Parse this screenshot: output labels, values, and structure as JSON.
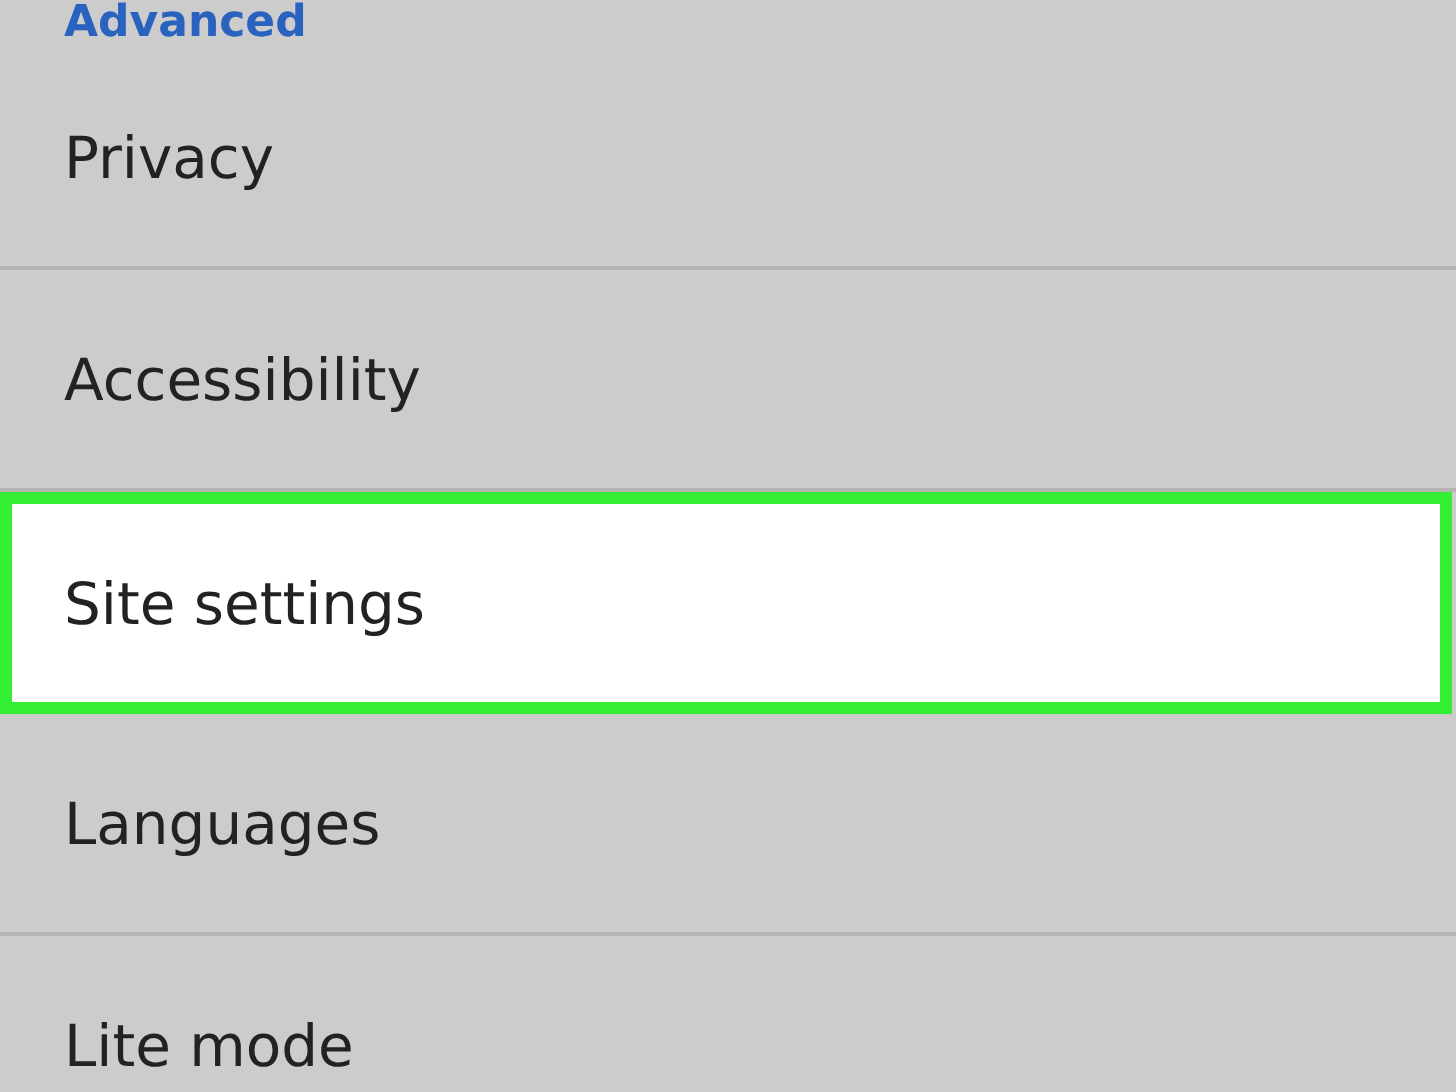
{
  "section_header": "Advanced",
  "items": [
    {
      "label": "Privacy",
      "highlighted": false
    },
    {
      "label": "Accessibility",
      "highlighted": false
    },
    {
      "label": "Site settings",
      "highlighted": true
    },
    {
      "label": "Languages",
      "highlighted": false
    },
    {
      "label": "Lite mode",
      "highlighted": false
    }
  ]
}
